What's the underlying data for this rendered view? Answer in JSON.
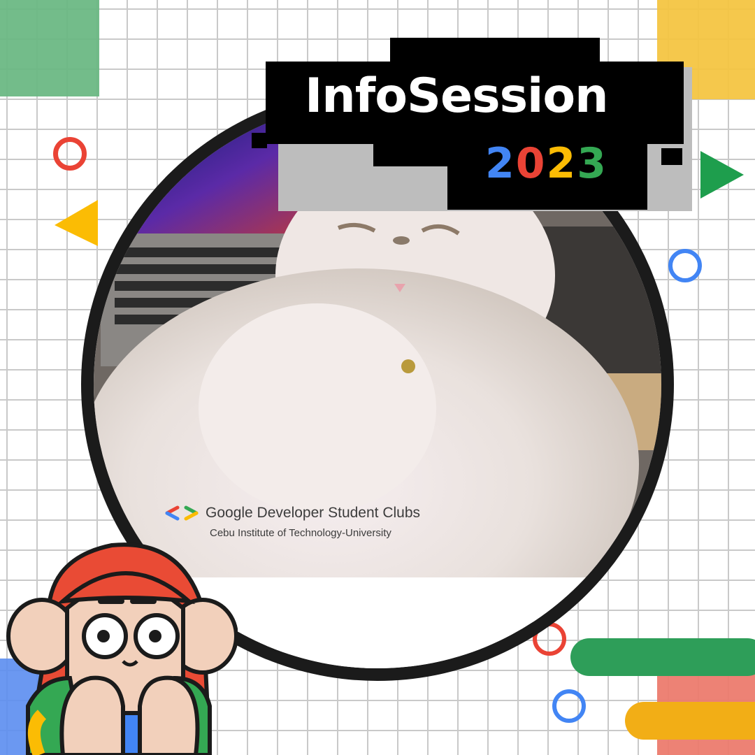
{
  "title": "InfoSession",
  "year_digits": [
    {
      "char": "2",
      "color": "#4285f4"
    },
    {
      "char": "0",
      "color": "#ea4335"
    },
    {
      "char": "2",
      "color": "#fbbc04"
    },
    {
      "char": "3",
      "color": "#34a853"
    }
  ],
  "organization": {
    "name": "Google Developer Student Clubs",
    "chapter": "Cebu Institute of Technology-University"
  },
  "colors": {
    "google_blue": "#4285f4",
    "google_red": "#ea4335",
    "google_yellow": "#fbbc04",
    "google_green": "#34a853"
  },
  "icons": [
    "gdsc-logo-icon",
    "play-triangle-icon",
    "ring-icon",
    "mascot-avatar"
  ]
}
